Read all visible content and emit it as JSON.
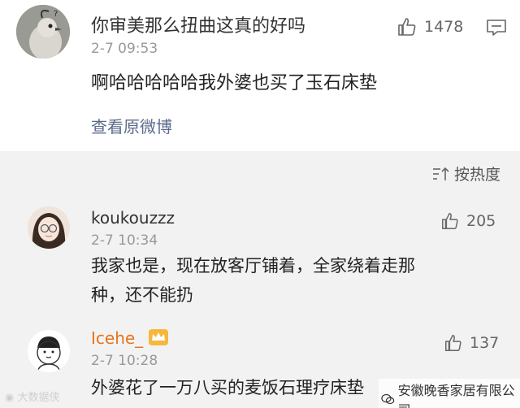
{
  "main_comment": {
    "username": "你审美那么扭曲这真的好吗",
    "time": "2-7 09:53",
    "likes": "1478",
    "content": "啊哈哈哈哈哈我外婆也买了玉石床垫",
    "view_original": "查看原微博"
  },
  "sort": {
    "label": "按热度"
  },
  "comments": [
    {
      "username": "koukouzzz",
      "time": "2-7 10:34",
      "likes": "205",
      "content_line1": "我家也是，现在放客厅铺着，全家绕着走那",
      "content_line2": "种，还不能扔"
    },
    {
      "username": "Icehe_",
      "time": "2-7 10:28",
      "likes": "137",
      "content_line1": "外婆花了一万八买的麦饭石理疗床垫"
    }
  ],
  "watermarks": {
    "left": "大数据侠",
    "right": "安徽晚香家居有限公司"
  },
  "colors": {
    "accent_orange": "#e8721c",
    "link_blue": "#5b6b8c"
  }
}
